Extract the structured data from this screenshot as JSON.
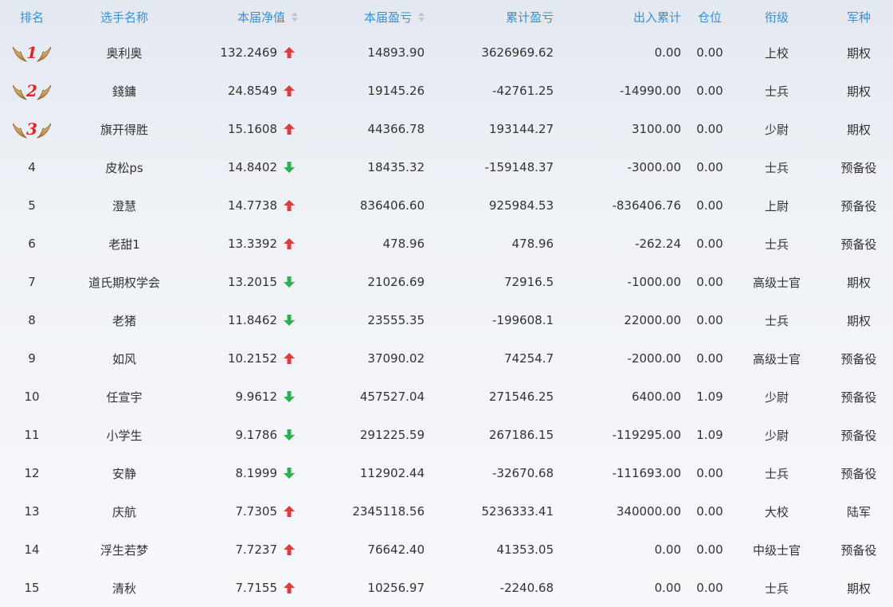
{
  "header": {
    "rank": "排名",
    "name": "选手名称",
    "nav": "本届净值",
    "current_pnl": "本届盈亏",
    "cumulative_pnl": "累计盈亏",
    "in_out": "出入累计",
    "position": "仓位",
    "grade": "衔级",
    "branch": "军种"
  },
  "colors": {
    "header_text": "#3b8fd8",
    "up_arrow": "#e23b3b",
    "down_arrow": "#2bb24c",
    "medal_number": "#e02424"
  },
  "rows": [
    {
      "rank": "1",
      "name": "奥利奥",
      "nav": "132.2469",
      "trend": "up",
      "current_pnl": "14893.90",
      "cumulative_pnl": "3626969.62",
      "in_out": "0.00",
      "position": "0.00",
      "grade": "上校",
      "branch": "期权"
    },
    {
      "rank": "2",
      "name": "錢鏞",
      "nav": "24.8549",
      "trend": "up",
      "current_pnl": "19145.26",
      "cumulative_pnl": "-42761.25",
      "in_out": "-14990.00",
      "position": "0.00",
      "grade": "士兵",
      "branch": "期权"
    },
    {
      "rank": "3",
      "name": "旗开得胜",
      "nav": "15.1608",
      "trend": "up",
      "current_pnl": "44366.78",
      "cumulative_pnl": "193144.27",
      "in_out": "3100.00",
      "position": "0.00",
      "grade": "少尉",
      "branch": "期权"
    },
    {
      "rank": "4",
      "name": "皮松ps",
      "nav": "14.8402",
      "trend": "down",
      "current_pnl": "18435.32",
      "cumulative_pnl": "-159148.37",
      "in_out": "-3000.00",
      "position": "0.00",
      "grade": "士兵",
      "branch": "预备役"
    },
    {
      "rank": "5",
      "name": "澄慧",
      "nav": "14.7738",
      "trend": "up",
      "current_pnl": "836406.60",
      "cumulative_pnl": "925984.53",
      "in_out": "-836406.76",
      "position": "0.00",
      "grade": "上尉",
      "branch": "预备役"
    },
    {
      "rank": "6",
      "name": "老甜1",
      "nav": "13.3392",
      "trend": "up",
      "current_pnl": "478.96",
      "cumulative_pnl": "478.96",
      "in_out": "-262.24",
      "position": "0.00",
      "grade": "士兵",
      "branch": "预备役"
    },
    {
      "rank": "7",
      "name": "道氏期权学会",
      "nav": "13.2015",
      "trend": "down",
      "current_pnl": "21026.69",
      "cumulative_pnl": "72916.5",
      "in_out": "-1000.00",
      "position": "0.00",
      "grade": "高级士官",
      "branch": "期权"
    },
    {
      "rank": "8",
      "name": "老猪",
      "nav": "11.8462",
      "trend": "down",
      "current_pnl": "23555.35",
      "cumulative_pnl": "-199608.1",
      "in_out": "22000.00",
      "position": "0.00",
      "grade": "士兵",
      "branch": "期权"
    },
    {
      "rank": "9",
      "name": "如风",
      "nav": "10.2152",
      "trend": "up",
      "current_pnl": "37090.02",
      "cumulative_pnl": "74254.7",
      "in_out": "-2000.00",
      "position": "0.00",
      "grade": "高级士官",
      "branch": "预备役"
    },
    {
      "rank": "10",
      "name": "任宣宇",
      "nav": "9.9612",
      "trend": "down",
      "current_pnl": "457527.04",
      "cumulative_pnl": "271546.25",
      "in_out": "6400.00",
      "position": "1.09",
      "grade": "少尉",
      "branch": "预备役"
    },
    {
      "rank": "11",
      "name": "小学生",
      "nav": "9.1786",
      "trend": "down",
      "current_pnl": "291225.59",
      "cumulative_pnl": "267186.15",
      "in_out": "-119295.00",
      "position": "1.09",
      "grade": "少尉",
      "branch": "预备役"
    },
    {
      "rank": "12",
      "name": "安静",
      "nav": "8.1999",
      "trend": "down",
      "current_pnl": "112902.44",
      "cumulative_pnl": "-32670.68",
      "in_out": "-111693.00",
      "position": "0.00",
      "grade": "士兵",
      "branch": "预备役"
    },
    {
      "rank": "13",
      "name": "庆航",
      "nav": "7.7305",
      "trend": "up",
      "current_pnl": "2345118.56",
      "cumulative_pnl": "5236333.41",
      "in_out": "340000.00",
      "position": "0.00",
      "grade": "大校",
      "branch": "陆军"
    },
    {
      "rank": "14",
      "name": "浮生若梦",
      "nav": "7.7237",
      "trend": "up",
      "current_pnl": "76642.40",
      "cumulative_pnl": "41353.05",
      "in_out": "0.00",
      "position": "0.00",
      "grade": "中级士官",
      "branch": "预备役"
    },
    {
      "rank": "15",
      "name": "清秋",
      "nav": "7.7155",
      "trend": "up",
      "current_pnl": "10256.97",
      "cumulative_pnl": "-2240.68",
      "in_out": "0.00",
      "position": "0.00",
      "grade": "士兵",
      "branch": "期权"
    }
  ]
}
